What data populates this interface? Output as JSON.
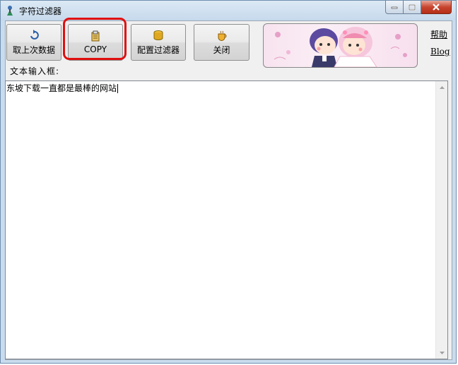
{
  "window": {
    "title": "字符过滤器"
  },
  "toolbar": {
    "last_data_label": "取上次数据",
    "copy_label": "COPY",
    "config_label": "配置过滤器",
    "close_label": "关闭"
  },
  "links": {
    "help": "帮助",
    "blog": "Blog"
  },
  "input": {
    "label": "文本输入框:",
    "value": "东坡下载一直都是最棒的网站"
  },
  "colors": {
    "highlight": "#e01010",
    "close_button": "#c7452f"
  }
}
